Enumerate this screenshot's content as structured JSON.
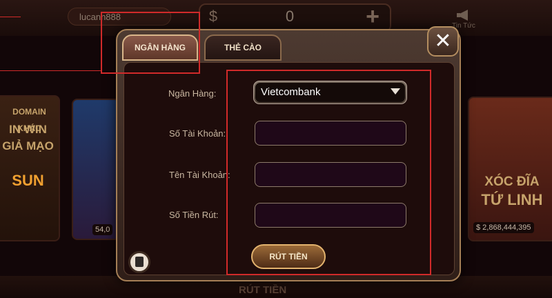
{
  "header": {
    "username": "lucann888",
    "balance_symbol": "$",
    "balance_value": "0",
    "add_symbol": "+",
    "news_label": "Tin Tức"
  },
  "background_cards": {
    "left1_lines": [
      "DOMAIN KHÁC",
      "IN WIN",
      "GIẢ MẠO",
      "SUN"
    ],
    "left2_amount": "54,0",
    "right_lines": [
      "XÓC ĐĨA",
      "TỨ LINH"
    ],
    "right_amount": "$ 2,868,444,395"
  },
  "modal": {
    "tabs": [
      {
        "label": "NGÂN HÀNG",
        "active": true
      },
      {
        "label": "THẺ CÀO",
        "active": false
      }
    ],
    "close_label": "✕",
    "form": {
      "bank_label": "Ngân Hàng:",
      "bank_value": "Vietcombank",
      "account_number_label": "Số Tài Khoản:",
      "account_number_value": "",
      "account_name_label": "Tên Tài Khoản:",
      "account_name_value": "",
      "amount_label": "Số Tiền Rút:",
      "amount_value": ""
    },
    "submit_label": "RÚT TIỀN"
  },
  "bottom_bar": {
    "label": "RÚT TIỀN"
  },
  "colors": {
    "highlight": "#d12a2a",
    "gold": "#d9b68a"
  }
}
